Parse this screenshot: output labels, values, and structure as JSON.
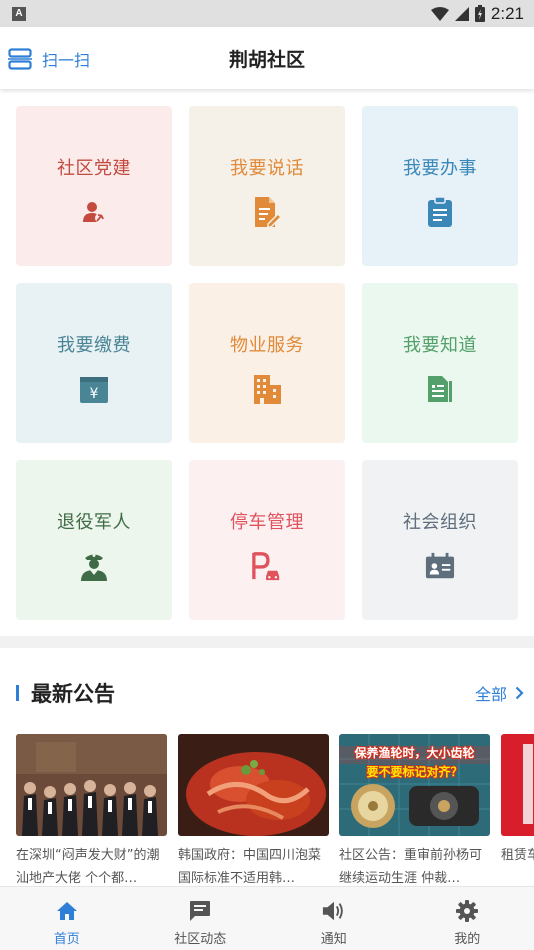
{
  "status_bar": {
    "indicator": "A",
    "time": "2:21"
  },
  "header": {
    "scan_label": "扫一扫",
    "title": "荆胡社区"
  },
  "tiles": [
    {
      "label": "社区党建",
      "icon": "party-emblem-icon",
      "color": "#c44a3f",
      "bg": "#fbeceb"
    },
    {
      "label": "我要说话",
      "icon": "document-edit-icon",
      "color": "#e08a3a",
      "bg": "#f6f1e8"
    },
    {
      "label": "我要办事",
      "icon": "clipboard-icon",
      "color": "#3b87b8",
      "bg": "#e7f1f8"
    },
    {
      "label": "我要缴费",
      "icon": "payment-yen-icon",
      "color": "#4a8596",
      "bg": "#e8f1f3"
    },
    {
      "label": "物业服务",
      "icon": "building-icon",
      "color": "#e08a3a",
      "bg": "#fbf0e6"
    },
    {
      "label": "我要知道",
      "icon": "info-document-icon",
      "color": "#53a06a",
      "bg": "#ebf8ef"
    },
    {
      "label": "退役军人",
      "icon": "soldier-icon",
      "color": "#3f6b47",
      "bg": "#ecf6ec"
    },
    {
      "label": "停车管理",
      "icon": "parking-car-icon",
      "color": "#e0525c",
      "bg": "#fcf0f1"
    },
    {
      "label": "社会组织",
      "icon": "id-card-icon",
      "color": "#5f6e7c",
      "bg": "#f0f2f4"
    }
  ],
  "notices": {
    "title": "最新公告",
    "all_label": "全部",
    "items": [
      {
        "text": "在深圳“闷声发大财”的潮汕地产大佬 个个都…"
      },
      {
        "text": "韩国政府：中国四川泡菜国际标准不适用韩…"
      },
      {
        "text": "社区公告：重审前孙杨可继续运动生涯 仲裁…",
        "image_caption_1": "保养渔轮时，大小齿轮",
        "image_caption_2": "要不要标记对齐？"
      },
      {
        "text": "租赁车"
      }
    ]
  },
  "nav": [
    {
      "label": "首页",
      "icon": "home-icon",
      "active": true
    },
    {
      "label": "社区动态",
      "icon": "message-icon",
      "active": false
    },
    {
      "label": "通知",
      "icon": "speaker-icon",
      "active": false
    },
    {
      "label": "我的",
      "icon": "gear-icon",
      "active": false
    }
  ],
  "colors": {
    "accent": "#2f7fd8"
  }
}
